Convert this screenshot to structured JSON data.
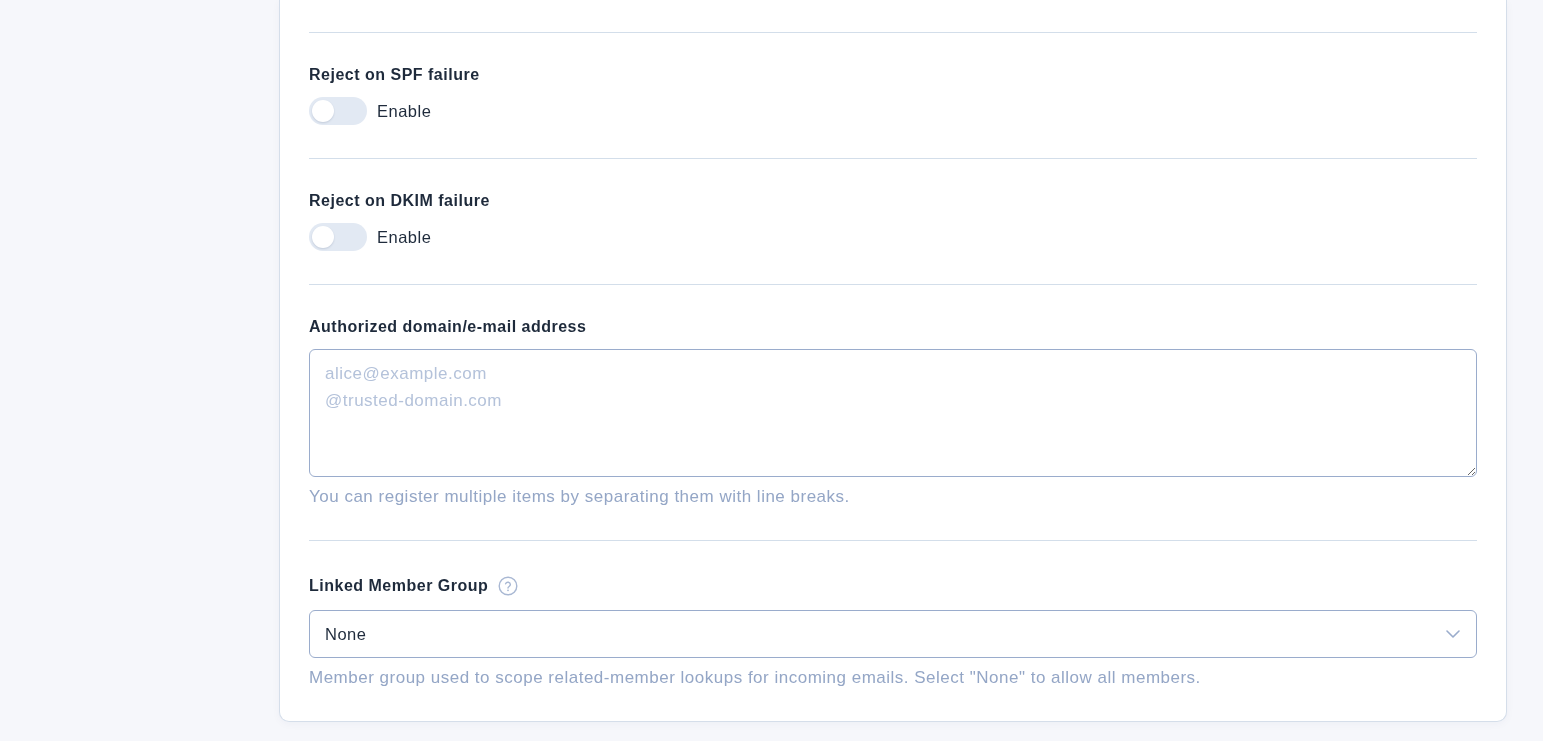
{
  "settings": [
    {
      "kind": "toggle",
      "label": "Reject on SPF failure",
      "toggle": {
        "label": "Enable",
        "on": false
      }
    },
    {
      "kind": "toggle",
      "label": "Reject on DKIM failure",
      "toggle": {
        "label": "Enable",
        "on": false
      }
    },
    {
      "kind": "textarea",
      "label": "Authorized domain/e-mail address",
      "placeholder": "alice@example.com\n@trusted-domain.com",
      "help_text": "You can register multiple items by separating them with line breaks."
    },
    {
      "kind": "select",
      "label": "Linked Member Group",
      "help_icon": true,
      "value": "None",
      "help_text": "Member group used to scope related-member lookups for incoming emails. Select \"None\" to allow all members."
    }
  ]
}
